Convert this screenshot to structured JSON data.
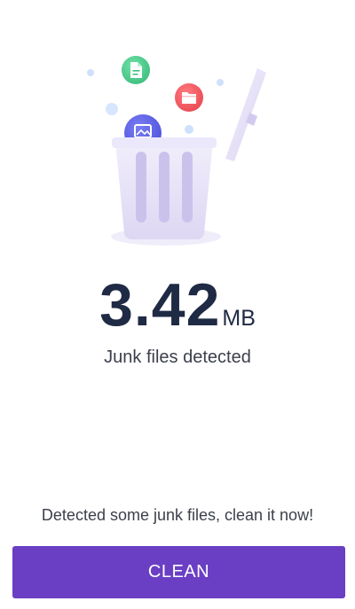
{
  "illustration": {
    "icons": [
      "document-icon",
      "folder-icon",
      "image-file-icon",
      "trash-bin-icon"
    ],
    "colors": {
      "document_bubble": "#4ecb8a",
      "folder_bubble": "#f2545b",
      "image_bubble": "#5b5fe6",
      "bin": "#e6e2f7",
      "dots": "#cfe0fb"
    }
  },
  "result": {
    "size_value": "3.42",
    "size_unit": "MB",
    "label": "Junk files detected"
  },
  "hint_text": "Detected some junk files, clean it now!",
  "clean_button_label": "CLEAN",
  "accent_color": "#6a3fc4"
}
